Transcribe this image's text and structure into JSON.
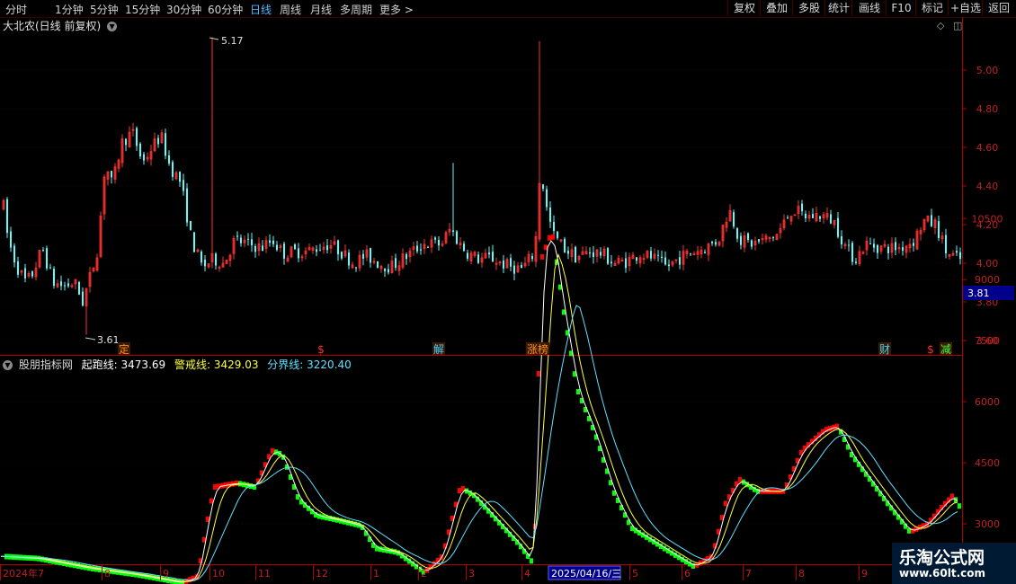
{
  "toolbar": {
    "periods": [
      "分时",
      "1分钟",
      "5分钟",
      "15分钟",
      "30分钟",
      "60分钟",
      "日线",
      "周线",
      "月线",
      "多周期",
      "更多 >"
    ],
    "active_period": "日线",
    "buttons": [
      "复权",
      "叠加",
      "多股",
      "统计",
      "画线",
      "F10",
      "标记",
      "+自选",
      "返回"
    ]
  },
  "main_chart": {
    "title": "大北农(日线 前复权)",
    "y_ticks": [
      "5.00",
      "4.80",
      "4.60",
      "4.40",
      "4.20",
      "4.00",
      "3.80",
      "3.60"
    ],
    "price_tag": "3.81",
    "high_label": "5.17",
    "low_label": "3.61",
    "event_markers": [
      {
        "label": "定",
        "color": "#ff8c1a"
      },
      {
        "label": "$",
        "color": "#ff3030"
      },
      {
        "label": "解",
        "color": "#40d0ff"
      },
      {
        "label": "涨榜",
        "color": "#ff8c1a"
      },
      {
        "label": "财",
        "color": "#40d0ff"
      },
      {
        "label": "$",
        "color": "#ff3030"
      },
      {
        "label": "减",
        "color": "#40ff40"
      }
    ]
  },
  "indicator": {
    "name": "股朋指标网",
    "line1": "起跑线: 3473.69",
    "line2": "警戒线: 3429.03",
    "line3": "分界线: 3220.40",
    "y_ticks": [
      "10500",
      "9000",
      "7500",
      "6000",
      "4500",
      "3000"
    ]
  },
  "x_axis": {
    "labels": [
      "2024年7",
      "8",
      "9",
      "10",
      "11",
      "12",
      "1",
      "2",
      "3",
      "4",
      "5",
      "6",
      "7",
      "8",
      "9",
      "10"
    ],
    "cursor_date": "2025/04/16/三"
  },
  "watermark": {
    "line1": "乐淘公式网",
    "line2": "www.60lt.com"
  },
  "colors": {
    "up": "#ff3232",
    "down": "#54ffff",
    "axis": "#b00000",
    "ind_up": "#ff0000",
    "ind_down": "#00ff00",
    "line_yellow": "#ffff40",
    "line_white": "#ffffff",
    "line_cyan": "#60e0ff"
  }
}
